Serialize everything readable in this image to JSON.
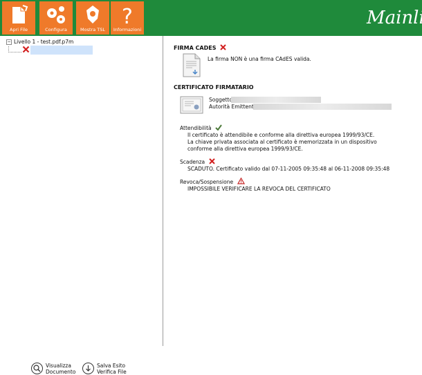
{
  "toolbar": {
    "buttons": [
      {
        "label": "Apri File",
        "icon": "open-file-icon"
      },
      {
        "label": "Configura",
        "icon": "gears-icon"
      },
      {
        "label": "Mostra TSL",
        "icon": "tsl-icon"
      },
      {
        "label": "Informazioni",
        "icon": "question-icon"
      }
    ],
    "brand": "Mainlin"
  },
  "tree": {
    "root_label": "Livello 1 - test.pdf.p7m"
  },
  "actions": {
    "view_line1": "Visualizza",
    "view_line2": "Documento",
    "save_line1": "Salva Esito",
    "save_line2": "Verifica File"
  },
  "signature": {
    "heading": "FIRMA CADES",
    "message": "La firma NON è una firma CAdES valida."
  },
  "certificate": {
    "heading": "CERTIFICATO FIRMATARIO",
    "subject_label": "Soggetto:",
    "issuer_label": "Autorità Emittente:"
  },
  "reliability": {
    "heading": "Attendibilità",
    "line1": "Il certificato è attendibile e conforme alla direttiva europea 1999/93/CE.",
    "line2": "La chiave privata associata al certificato è memorizzata in un dispositivo",
    "line3": "conforme alla direttiva europea 1999/93/CE."
  },
  "expiry": {
    "heading": "Scadenza",
    "message": "SCADUTO. Certificato valido dal 07-11-2005 09:35:48 al 06-11-2008 09:35:48"
  },
  "revocation": {
    "heading": "Revoca/Sospensione",
    "message": "IMPOSSIBILE VERIFICARE LA REVOCA DEL CERTIFICATO"
  },
  "colors": {
    "topbar": "#1f8a3b",
    "button": "#ef7a2a",
    "error": "#d21f1f"
  }
}
